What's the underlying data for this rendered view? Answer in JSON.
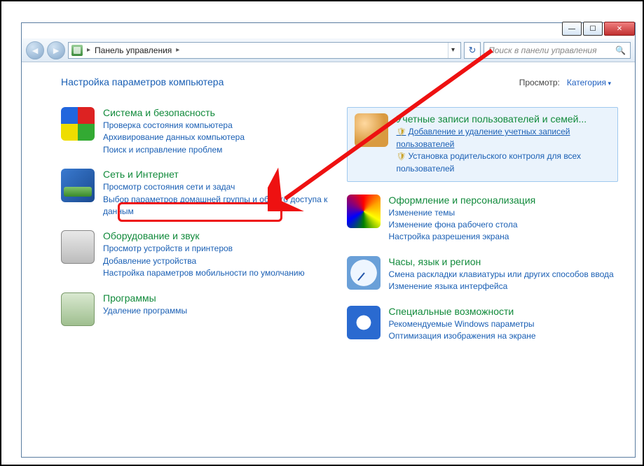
{
  "breadcrumb": {
    "root": "Панель управления"
  },
  "search": {
    "placeholder": "Поиск в панели управления"
  },
  "page_title": "Настройка параметров компьютера",
  "view_label": "Просмотр:",
  "view_value": "Категория",
  "categories": {
    "left": [
      {
        "title": "Система и безопасность",
        "links": [
          "Проверка состояния компьютера",
          "Архивирование данных компьютера",
          "Поиск и исправление проблем"
        ]
      },
      {
        "title": "Сеть и Интернет",
        "links": [
          "Просмотр состояния сети и задач",
          "Выбор параметров домашней группы и общего доступа к данным"
        ]
      },
      {
        "title": "Оборудование и звук",
        "links": [
          "Просмотр устройств и принтеров",
          "Добавление устройства",
          "Настройка параметров мобильности по умолчанию"
        ]
      },
      {
        "title": "Программы",
        "links": [
          "Удаление программы"
        ]
      }
    ],
    "right": [
      {
        "title": "Учетные записи пользователей и семей...",
        "highlighted": true,
        "links": [
          {
            "text": "Добавление и удаление учетных записей пользователей",
            "shield": true,
            "underlined": true
          },
          {
            "text": "Установка родительского контроля для всех пользователей",
            "shield": true
          }
        ]
      },
      {
        "title": "Оформление и персонализация",
        "links": [
          "Изменение темы",
          "Изменение фона рабочего стола",
          "Настройка разрешения экрана"
        ]
      },
      {
        "title": "Часы, язык и регион",
        "links": [
          "Смена раскладки клавиатуры или других способов ввода",
          "Изменение языка интерфейса"
        ]
      },
      {
        "title": "Специальные возможности",
        "links": [
          "Рекомендуемые Windows параметры",
          "Оптимизация изображения на экране"
        ]
      }
    ]
  },
  "annotation": {
    "target_link": "Просмотр состояния сети и задач"
  }
}
